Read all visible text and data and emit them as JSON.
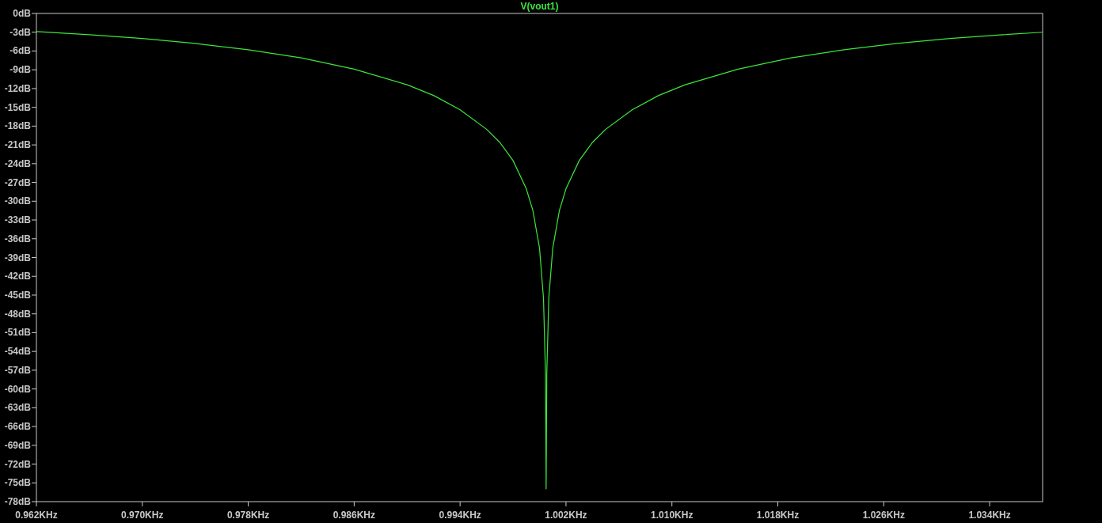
{
  "chart_data": {
    "type": "line",
    "xlim": [
      0.962,
      1.038
    ],
    "ylim": [
      -78,
      0
    ],
    "xticks": [
      {
        "value": 0.962,
        "label": "0.962KHz"
      },
      {
        "value": 0.97,
        "label": "0.970KHz"
      },
      {
        "value": 0.978,
        "label": "0.978KHz"
      },
      {
        "value": 0.986,
        "label": "0.986KHz"
      },
      {
        "value": 0.994,
        "label": "0.994KHz"
      },
      {
        "value": 1.002,
        "label": "1.002KHz"
      },
      {
        "value": 1.01,
        "label": "1.010KHz"
      },
      {
        "value": 1.018,
        "label": "1.018KHz"
      },
      {
        "value": 1.026,
        "label": "1.026KHz"
      },
      {
        "value": 1.034,
        "label": "1.034KHz"
      }
    ],
    "yticks": [
      {
        "value": 0,
        "label": "0dB"
      },
      {
        "value": -3,
        "label": "-3dB"
      },
      {
        "value": -6,
        "label": "-6dB"
      },
      {
        "value": -9,
        "label": "-9dB"
      },
      {
        "value": -12,
        "label": "-12dB"
      },
      {
        "value": -15,
        "label": "-15dB"
      },
      {
        "value": -18,
        "label": "-18dB"
      },
      {
        "value": -21,
        "label": "-21dB"
      },
      {
        "value": -24,
        "label": "-24dB"
      },
      {
        "value": -27,
        "label": "-27dB"
      },
      {
        "value": -30,
        "label": "-30dB"
      },
      {
        "value": -33,
        "label": "-33dB"
      },
      {
        "value": -36,
        "label": "-36dB"
      },
      {
        "value": -39,
        "label": "-39dB"
      },
      {
        "value": -42,
        "label": "-42dB"
      },
      {
        "value": -45,
        "label": "-45dB"
      },
      {
        "value": -48,
        "label": "-48dB"
      },
      {
        "value": -51,
        "label": "-51dB"
      },
      {
        "value": -54,
        "label": "-54dB"
      },
      {
        "value": -57,
        "label": "-57dB"
      },
      {
        "value": -60,
        "label": "-60dB"
      },
      {
        "value": -63,
        "label": "-63dB"
      },
      {
        "value": -66,
        "label": "-66dB"
      },
      {
        "value": -69,
        "label": "-69dB"
      },
      {
        "value": -72,
        "label": "-72dB"
      },
      {
        "value": -75,
        "label": "-75dB"
      },
      {
        "value": -78,
        "label": "-78dB"
      }
    ],
    "x": [
      0.962,
      0.966,
      0.97,
      0.974,
      0.978,
      0.982,
      0.986,
      0.99,
      0.992,
      0.994,
      0.996,
      0.997,
      0.998,
      0.999,
      0.9995,
      1.0,
      1.0003,
      1.00045,
      1.0005,
      1.00055,
      1.0007,
      1.001,
      1.0015,
      1.002,
      1.003,
      1.004,
      1.005,
      1.007,
      1.009,
      1.011,
      1.015,
      1.019,
      1.023,
      1.027,
      1.031,
      1.035,
      1.038
    ],
    "series": [
      {
        "name": "V(vout1)",
        "color": "#3ce63c",
        "values": [
          -2.9,
          -3.4,
          -4.0,
          -4.8,
          -5.8,
          -7.1,
          -8.9,
          -11.4,
          -13.1,
          -15.4,
          -18.5,
          -20.6,
          -23.5,
          -28.0,
          -31.5,
          -37.5,
          -45.5,
          -57.5,
          -76,
          -57.5,
          -45.5,
          -37.5,
          -31.5,
          -28.0,
          -23.5,
          -20.6,
          -18.5,
          -15.4,
          -13.1,
          -11.4,
          -8.9,
          -7.1,
          -5.8,
          -4.8,
          -4.0,
          -3.4,
          -3.0
        ]
      }
    ]
  }
}
